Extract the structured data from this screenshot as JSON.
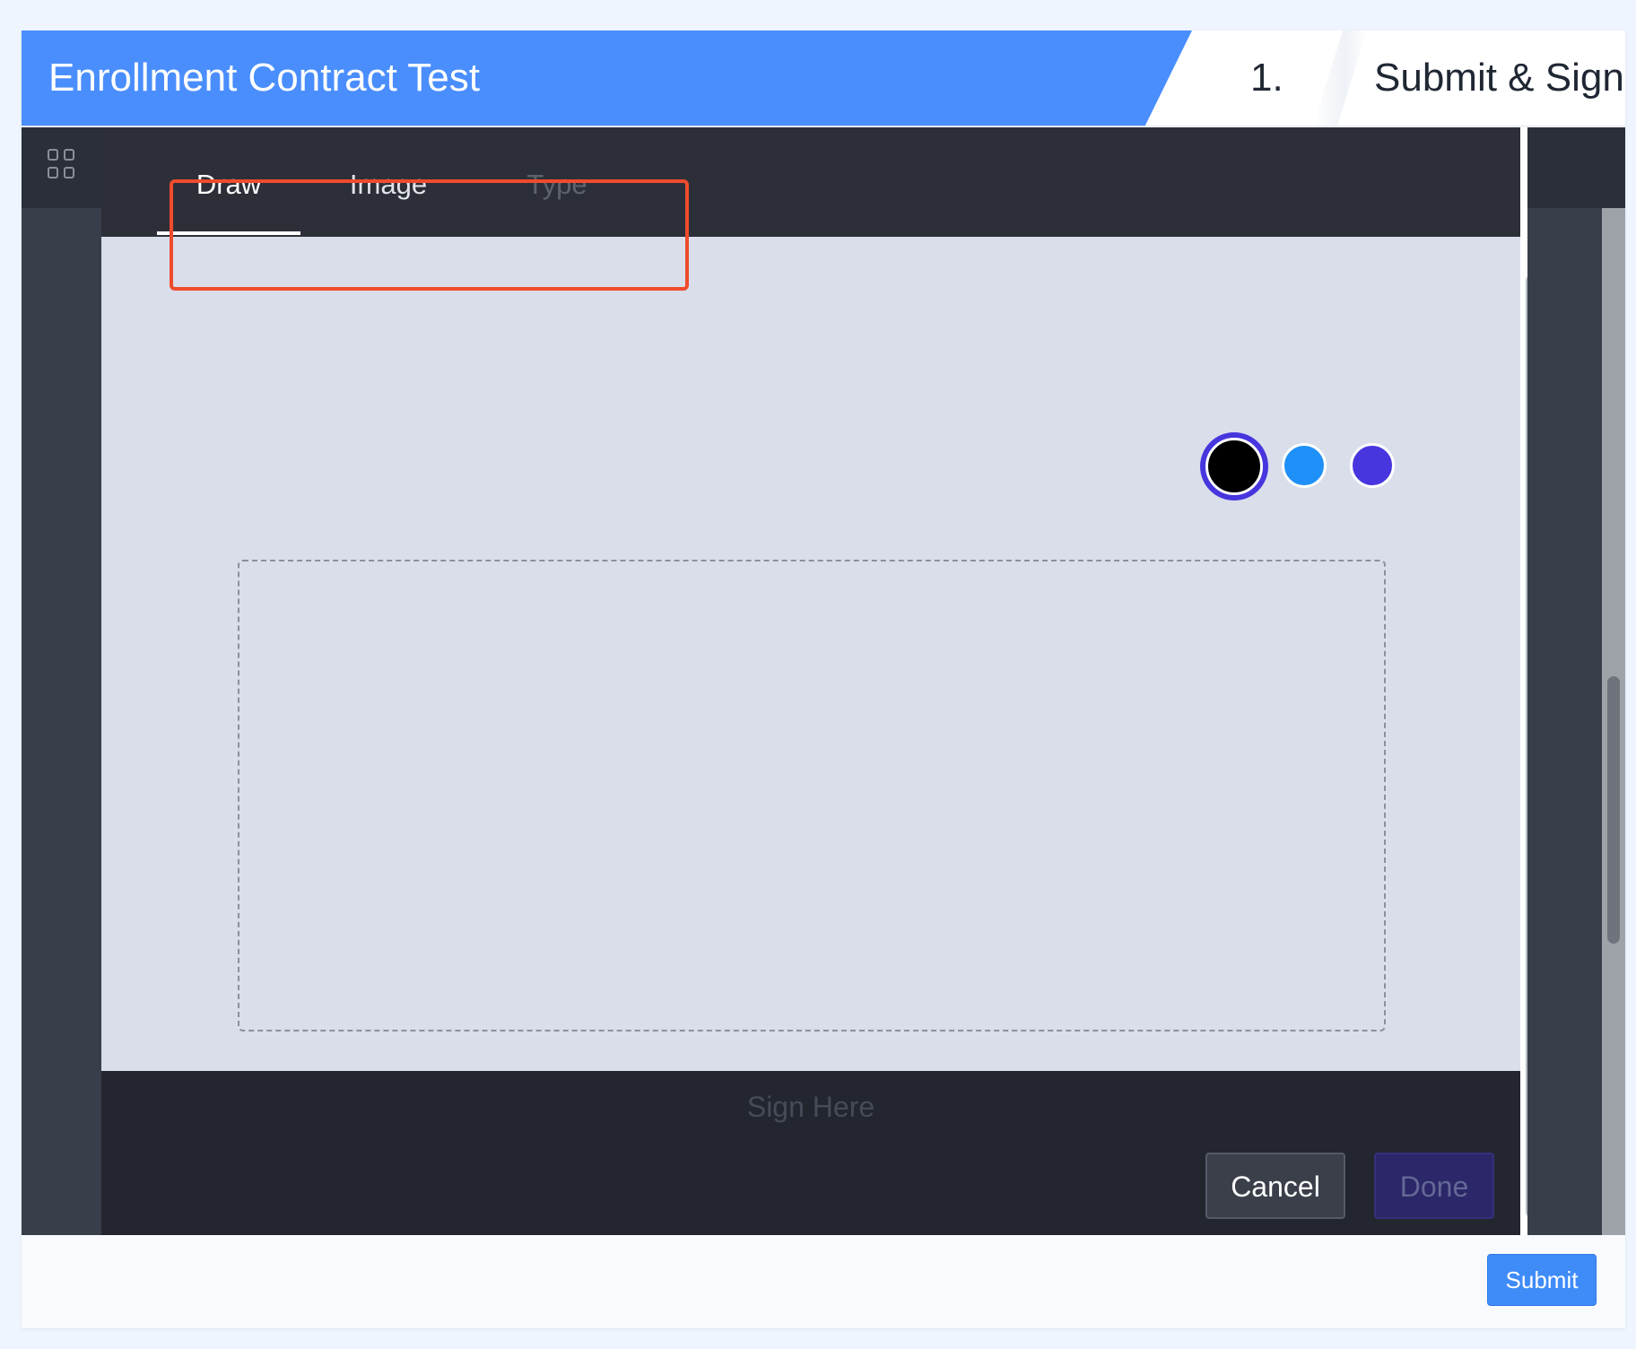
{
  "header": {
    "title": "Enrollment Contract Test",
    "step_number": "1.",
    "step_label": "Submit & Sign"
  },
  "toolbar": {
    "grid_icon": "grid-icon"
  },
  "signature_modal": {
    "tabs": [
      {
        "label": "Draw",
        "state": "active"
      },
      {
        "label": "Image",
        "state": "enabled"
      },
      {
        "label": "Type",
        "state": "disabled"
      }
    ],
    "color_swatches": [
      {
        "name": "black",
        "color": "#000000",
        "selected": true
      },
      {
        "name": "blue",
        "color": "#1f90f7",
        "selected": false
      },
      {
        "name": "purple",
        "color": "#4736de",
        "selected": false
      }
    ],
    "sign_here_label": "Sign Here",
    "cancel_label": "Cancel",
    "done_label": "Done"
  },
  "footer": {
    "submit_label": "Submit"
  },
  "colors": {
    "header_blue": "#4a8efd",
    "highlight_box": "#ef4b2d",
    "modal_dark": "#23262f",
    "sign_panel": "#d9deea",
    "submit_blue": "#3f8cf9"
  }
}
